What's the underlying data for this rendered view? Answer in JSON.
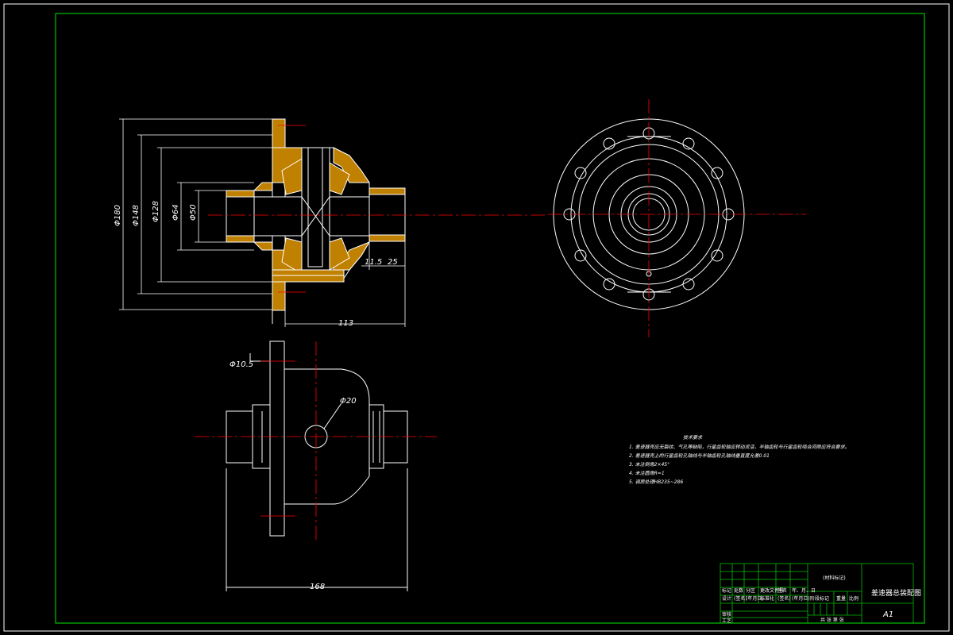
{
  "dimensions": {
    "d180": "Φ180",
    "d148": "Φ148",
    "d128": "Φ128",
    "d64": "Φ64",
    "d50": "Φ50",
    "len113": "113",
    "len11_5": "11.5",
    "len25": "25",
    "hole10_5": "Φ10.5",
    "hole20": "Φ20",
    "len168": "168"
  },
  "technical_requirements": {
    "title": "技术要求",
    "items": [
      "1. 差速器壳应无裂纹、气孔等缺陷，行星齿轮轴应转动灵活，半轴齿轮与行星齿轮啮合间隙应符合要求。",
      "2. 差速器壳上的行星齿轮孔轴线与半轴齿轮孔轴线垂直度允差0.01",
      "3. 未注倒角2×45°",
      "4. 未注圆角R=1",
      "5. 调质处理HB235~286"
    ]
  },
  "title_block": {
    "material_mark": "(材料标记)",
    "drawing_name": "差速器总装配图",
    "scale_label": "比例",
    "sheet_size": "A1",
    "stage_mark": "阶段标记",
    "weight_label": "重量",
    "ratio_label": "比例",
    "row_labels": [
      "标记",
      "设计",
      "审核",
      "工艺"
    ],
    "row_cells": [
      "处数",
      "分区",
      "更改文件号",
      "签名",
      "年、月、日"
    ],
    "row_cells2": [
      "(签名)",
      "(年月日)",
      "标准化",
      "(签名)",
      "(年月日)"
    ],
    "sheet_text": "共 张 第 张"
  },
  "colors": {
    "background": "#000000",
    "frame": "#00c000",
    "lines": "#ffffff",
    "centerline": "#ff0000",
    "hatch": "#c08000"
  }
}
